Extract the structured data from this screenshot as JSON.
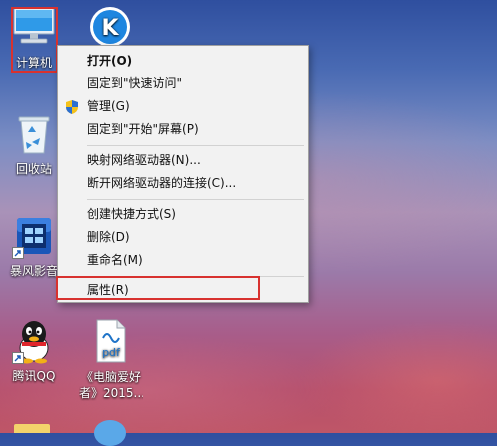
{
  "desktop": {
    "icons": [
      {
        "label": "计算机"
      },
      {
        "label": "回收站"
      },
      {
        "label": "暴风影音"
      },
      {
        "label": "腾讯QQ"
      },
      {
        "label_line1": "《电脑爱好",
        "label_line2": "者》2015..."
      },
      {
        "top_glyph": "K"
      },
      {
        "pdf_text": "pdf"
      }
    ]
  },
  "context_menu": {
    "items": [
      {
        "label": "打开(O)"
      },
      {
        "label": "固定到\"快速访问\""
      },
      {
        "label": "管理(G)"
      },
      {
        "label": "固定到\"开始\"屏幕(P)"
      },
      {
        "label": "映射网络驱动器(N)..."
      },
      {
        "label": "断开网络驱动器的连接(C)..."
      },
      {
        "label": "创建快捷方式(S)"
      },
      {
        "label": "删除(D)"
      },
      {
        "label": "重命名(M)"
      },
      {
        "label": "属性(R)"
      }
    ]
  },
  "colors": {
    "highlight_red": "#d8322f",
    "menu_bg": "#f2f2f2",
    "menu_border": "#a0a0a0"
  },
  "icons": {
    "computer": "computer-icon",
    "recycle_bin": "recycle-bin-icon",
    "baofeng": "baofeng-icon",
    "qq": "qq-icon",
    "pdf": "pdf-file-icon",
    "k_app": "k-app-icon",
    "shield": "shield-icon"
  }
}
